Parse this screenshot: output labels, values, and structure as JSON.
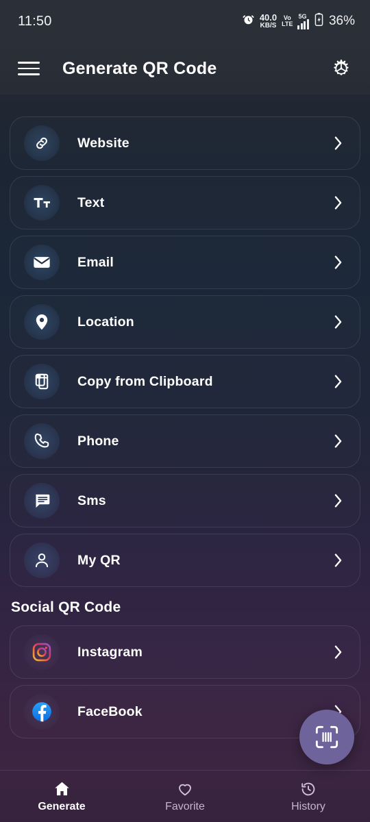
{
  "status_bar": {
    "time": "11:50",
    "alarm_icon": "alarm-clock-icon",
    "net_speed_value": "40.0",
    "net_speed_unit": "KB/S",
    "volte_line1": "Vo",
    "volte_line2": "LTE",
    "network_type": "5G",
    "signal_icon": "signal-bars-icon",
    "battery_icon": "battery-charging-icon",
    "battery_percent": "36%"
  },
  "header": {
    "menu_icon": "hamburger-menu-icon",
    "title": "Generate QR Code",
    "settings_icon": "gear-icon"
  },
  "main": {
    "items": [
      {
        "label": "Website",
        "icon": "link-icon"
      },
      {
        "label": "Text",
        "icon": "text-format-icon"
      },
      {
        "label": "Email",
        "icon": "envelope-icon"
      },
      {
        "label": "Location",
        "icon": "map-pin-icon"
      },
      {
        "label": "Copy from Clipboard",
        "icon": "copy-icon"
      },
      {
        "label": "Phone",
        "icon": "phone-icon"
      },
      {
        "label": "Sms",
        "icon": "chat-bubble-icon"
      },
      {
        "label": "My QR",
        "icon": "person-icon"
      }
    ],
    "social_section_title": "Social QR Code",
    "social_items": [
      {
        "label": "Instagram",
        "icon": "instagram-icon"
      },
      {
        "label": "FaceBook",
        "icon": "facebook-icon"
      }
    ],
    "chevron_icon": "chevron-right-icon"
  },
  "fab": {
    "icon": "barcode-scan-icon"
  },
  "bottom_nav": {
    "items": [
      {
        "label": "Generate",
        "icon": "home-icon",
        "active": true
      },
      {
        "label": "Favorite",
        "icon": "heart-icon",
        "active": false
      },
      {
        "label": "History",
        "icon": "history-clock-icon",
        "active": false
      }
    ]
  },
  "colors": {
    "background_top": "#222833",
    "background_mid": "#1b2738",
    "background_bottom": "#3b2540",
    "fab": "#6f639c",
    "accent_text": "#ffffff",
    "facebook_blue": "#1b8cf5"
  }
}
